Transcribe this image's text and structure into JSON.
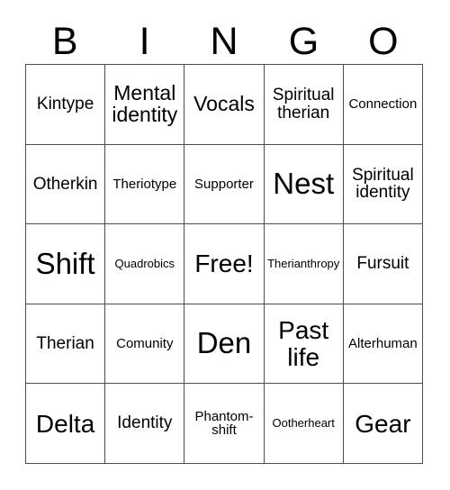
{
  "card": {
    "type": "bingo-card",
    "columns": 5,
    "rows": 5,
    "border_color": "#4d4d4d",
    "background_color": "#ffffff",
    "text_color": "#000000"
  },
  "header": {
    "letters": [
      "B",
      "I",
      "N",
      "G",
      "O"
    ]
  },
  "grid": {
    "rows": [
      {
        "cells": [
          {
            "label": "Kintype",
            "size": "md"
          },
          {
            "label": "Mental identity",
            "size": "lg"
          },
          {
            "label": "Vocals",
            "size": "lg"
          },
          {
            "label": "Spiritual therian",
            "size": "md"
          },
          {
            "label": "Connection",
            "size": "sm"
          }
        ]
      },
      {
        "cells": [
          {
            "label": "Otherkin",
            "size": "md"
          },
          {
            "label": "Theriotype",
            "size": "sm"
          },
          {
            "label": "Supporter",
            "size": "sm"
          },
          {
            "label": "Nest",
            "size": "xxl"
          },
          {
            "label": "Spiritual identity",
            "size": "md"
          }
        ]
      },
      {
        "cells": [
          {
            "label": "Shift",
            "size": "xxl"
          },
          {
            "label": "Quadrobics",
            "size": "xs"
          },
          {
            "label": "Free!",
            "size": "xl"
          },
          {
            "label": "Therianthropy",
            "size": "xs"
          },
          {
            "label": "Fursuit",
            "size": "md"
          }
        ]
      },
      {
        "cells": [
          {
            "label": "Therian",
            "size": "md"
          },
          {
            "label": "Comunity",
            "size": "sm"
          },
          {
            "label": "Den",
            "size": "xxl"
          },
          {
            "label": "Past life",
            "size": "xl"
          },
          {
            "label": "Alterhuman",
            "size": "sm"
          }
        ]
      },
      {
        "cells": [
          {
            "label": "Delta",
            "size": "xl"
          },
          {
            "label": "Identity",
            "size": "md"
          },
          {
            "label": "Phantom-shift",
            "size": "sm"
          },
          {
            "label": "Ootherheart",
            "size": "xs"
          },
          {
            "label": "Gear",
            "size": "xl"
          }
        ]
      }
    ]
  }
}
